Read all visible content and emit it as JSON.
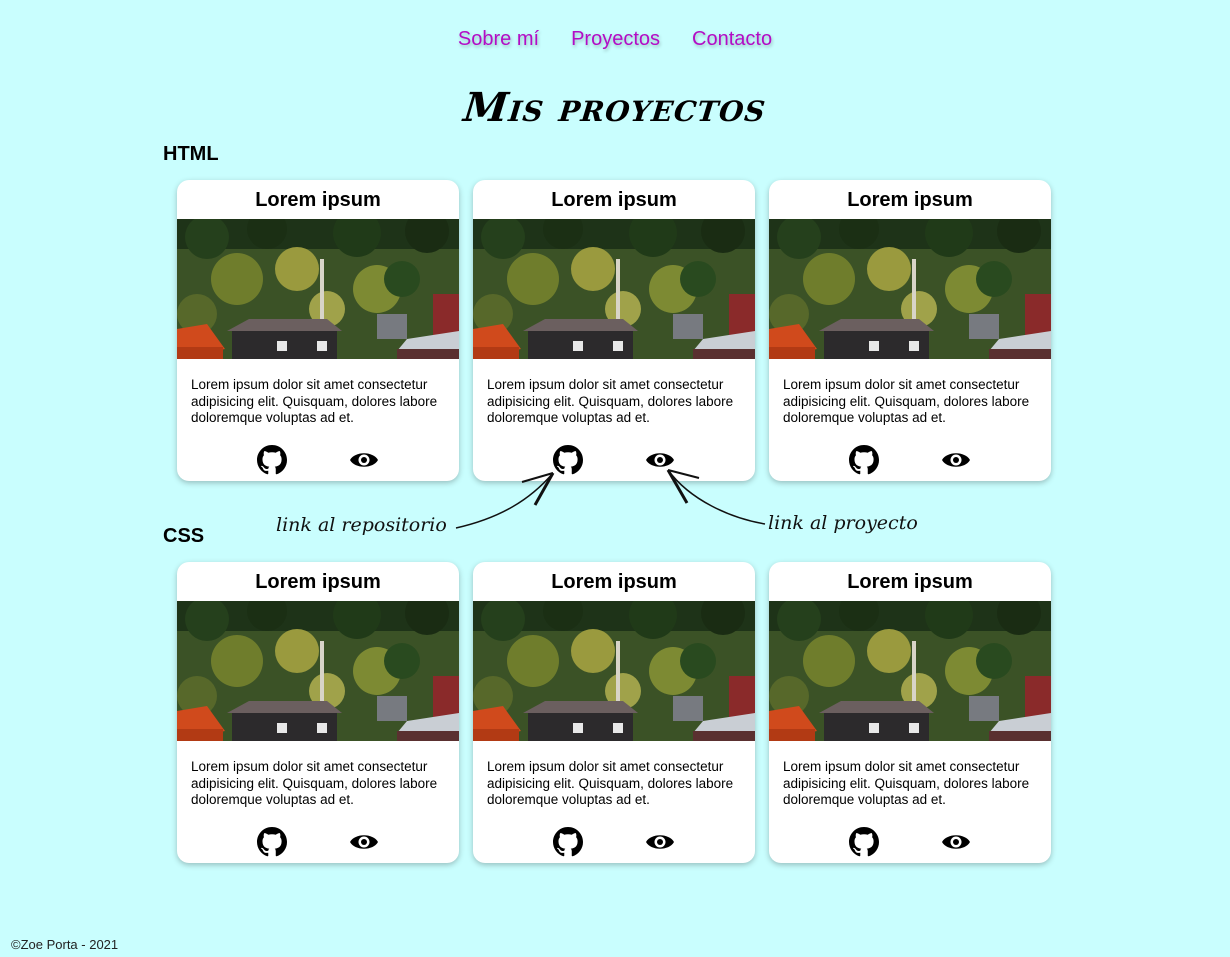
{
  "nav": {
    "items": [
      "Sobre mí",
      "Proyectos",
      "Contacto"
    ]
  },
  "page_title": "Mis proyectos",
  "sections": [
    {
      "title": "HTML",
      "cards": [
        {
          "title": "Lorem ipsum",
          "text": "Lorem ipsum dolor sit amet consectetur adipisicing elit. Quisquam, dolores labore doloremque voluptas ad et."
        },
        {
          "title": "Lorem ipsum",
          "text": "Lorem ipsum dolor sit amet consectetur adipisicing elit. Quisquam, dolores labore doloremque voluptas ad et."
        },
        {
          "title": "Lorem ipsum",
          "text": "Lorem ipsum dolor sit amet consectetur adipisicing elit. Quisquam, dolores labore doloremque voluptas ad et."
        }
      ]
    },
    {
      "title": "CSS",
      "cards": [
        {
          "title": "Lorem ipsum",
          "text": "Lorem ipsum dolor sit amet consectetur adipisicing elit. Quisquam, dolores labore doloremque voluptas ad et."
        },
        {
          "title": "Lorem ipsum",
          "text": "Lorem ipsum dolor sit amet consectetur adipisicing elit. Quisquam, dolores labore doloremque voluptas ad et."
        },
        {
          "title": "Lorem ipsum",
          "text": "Lorem ipsum dolor sit amet consectetur adipisicing elit. Quisquam, dolores labore doloremque voluptas ad et."
        }
      ]
    }
  ],
  "annotations": {
    "repo": "link al repositorio",
    "project": "link al proyecto"
  },
  "icons": {
    "repo": "github-icon",
    "project": "eye-icon"
  },
  "colors": {
    "background": "#c9fefe",
    "nav_link": "#b30cc6",
    "card": "#ffffff"
  },
  "footer": "©Zoe Porta - 2021"
}
